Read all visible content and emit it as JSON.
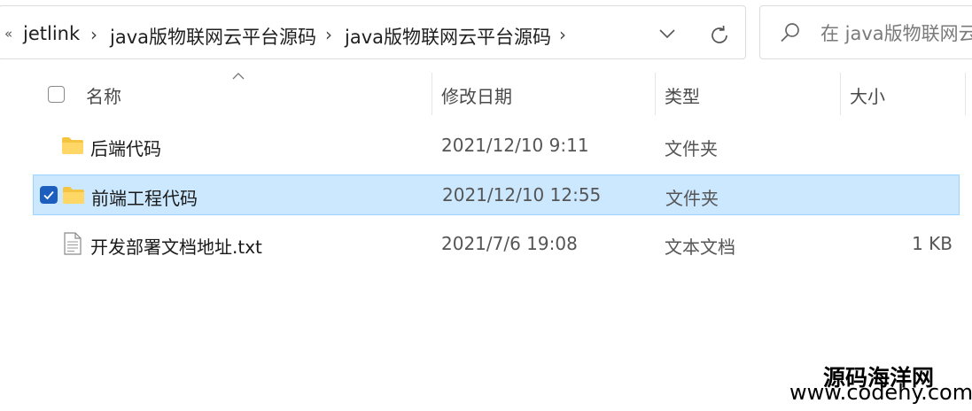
{
  "address_bar": {
    "overflow": "«",
    "crumbs": [
      "jetlink",
      "java版物联网云平台源码",
      "java版物联网云平台源码"
    ],
    "separator": "›"
  },
  "search": {
    "placeholder": "在 java版物联网云"
  },
  "columns": {
    "name": "名称",
    "date": "修改日期",
    "type": "类型",
    "size": "大小"
  },
  "rows": [
    {
      "name": "后端代码",
      "date": "2021/12/10 9:11",
      "type": "文件夹",
      "size": "",
      "icon": "folder-icon",
      "selected": false
    },
    {
      "name": "前端工程代码",
      "date": "2021/12/10 12:55",
      "type": "文件夹",
      "size": "",
      "icon": "folder-icon",
      "selected": true
    },
    {
      "name": "开发部署文档地址.txt",
      "date": "2021/7/6 19:08",
      "type": "文本文档",
      "size": "1 KB",
      "icon": "text-file-icon",
      "selected": false
    }
  ],
  "watermark": {
    "line1": "源码海洋网",
    "line2": "www.codehy.com"
  },
  "colors": {
    "selection_bg": "#cce8ff",
    "selection_border": "#99d1ff",
    "checkbox_accent": "#1d5fbf",
    "folder": "#f5c542"
  }
}
